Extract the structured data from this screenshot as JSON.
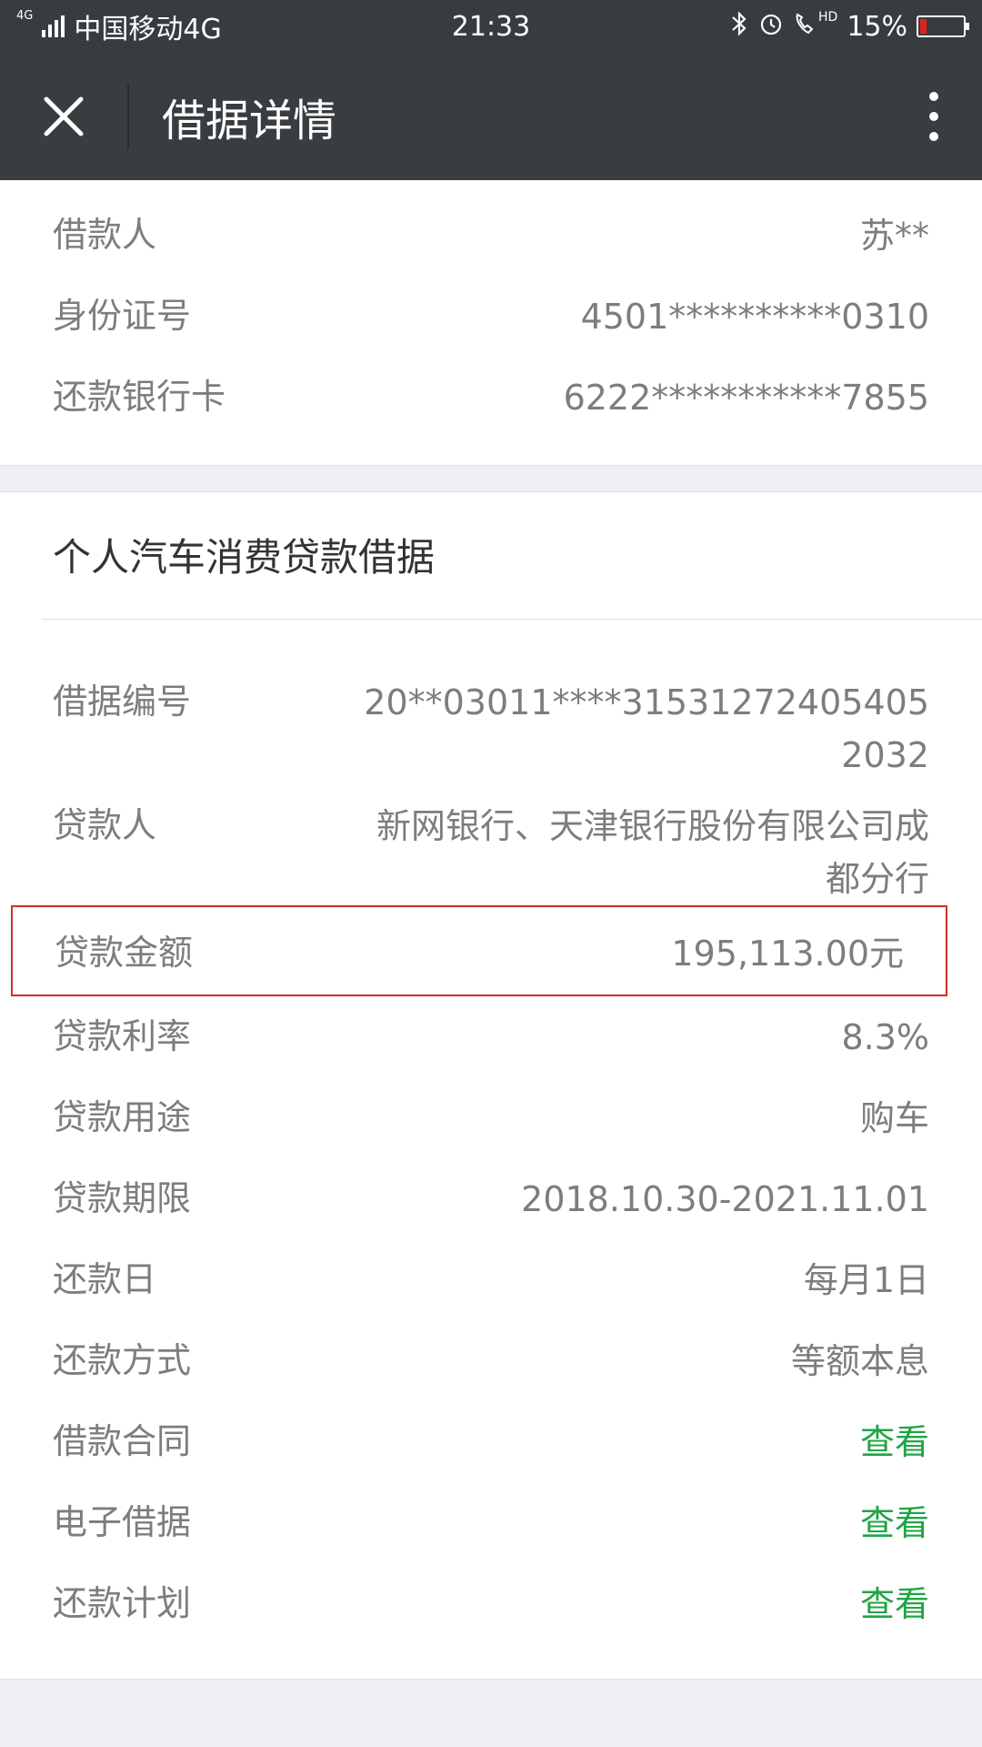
{
  "status_bar": {
    "network_tag": "4G",
    "carrier": "中国移动4G",
    "time": "21:33",
    "bluetooth_icon": "bluetooth-icon",
    "alarm_icon": "alarm-icon",
    "hd_label": "HD",
    "battery_percent": "15%",
    "battery_level": 0.15,
    "battery_color": "#e02020"
  },
  "header": {
    "title": "借据详情",
    "close_icon": "close-icon",
    "more_icon": "more-vertical-icon"
  },
  "borrower_info": [
    {
      "label": "借款人",
      "value": "苏**"
    },
    {
      "label": "身份证号",
      "value": "4501**********0310"
    },
    {
      "label": "还款银行卡",
      "value": "6222***********7855"
    }
  ],
  "loan": {
    "title": "个人汽车消费贷款借据",
    "number_label": "借据编号",
    "number_value": "20**03011****315312724054052032",
    "lender_label": "贷款人",
    "lender_value": "新网银行、天津银行股份有限公司成都分行",
    "amount_label": "贷款金额",
    "amount_value": "195,113.00元",
    "highlight_color": "#c9302c",
    "rows": [
      {
        "label": "贷款利率",
        "value": "8.3%"
      },
      {
        "label": "贷款用途",
        "value": "购车"
      },
      {
        "label": "贷款期限",
        "value": "2018.10.30-2021.11.01"
      },
      {
        "label": "还款日",
        "value": "每月1日"
      },
      {
        "label": "还款方式",
        "value": "等额本息"
      }
    ],
    "links": [
      {
        "label": "借款合同",
        "value": "查看"
      },
      {
        "label": "电子借据",
        "value": "查看"
      },
      {
        "label": "还款计划",
        "value": "查看"
      }
    ],
    "link_color": "#1fa544"
  }
}
